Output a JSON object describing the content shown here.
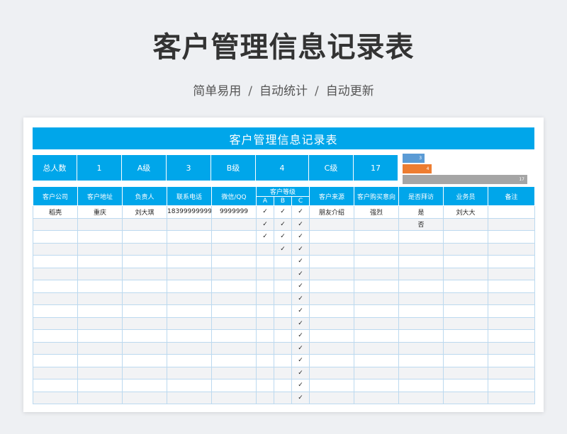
{
  "page": {
    "title": "客户管理信息记录表",
    "subtitle_parts": [
      "简单易用",
      "自动统计",
      "自动更新"
    ],
    "separator": "/"
  },
  "sheet": {
    "title": "客户管理信息记录表",
    "summary": [
      {
        "label": "总人数",
        "value": "1"
      },
      {
        "label": "A级",
        "value": "3"
      },
      {
        "label": "B级",
        "value": "4"
      },
      {
        "label": "C级",
        "value": "17"
      }
    ],
    "bars": [
      {
        "label": "3",
        "value": 3
      },
      {
        "label": "4",
        "value": 4
      },
      {
        "label": "17",
        "value": 17
      }
    ],
    "headers": {
      "company": "客户公司",
      "address": "客户地址",
      "owner": "负责人",
      "phone": "联系电话",
      "wechat": "微信/QQ",
      "level": "客户等级",
      "level_a": "A",
      "level_b": "B",
      "level_c": "C",
      "source": "客户来源",
      "intent": "客户购买意向",
      "visited": "是否拜访",
      "salesman": "业务员",
      "remark": "备注"
    },
    "check_mark": "✓",
    "rows": [
      {
        "company": "稻壳",
        "address": "重庆",
        "owner": "刘大琪",
        "phone": "18399999999",
        "wechat": "9999999",
        "a": true,
        "b": true,
        "c": true,
        "source": "朋友介绍",
        "intent": "强烈",
        "visited": "是",
        "salesman": "刘大大",
        "remark": ""
      },
      {
        "company": "",
        "address": "",
        "owner": "",
        "phone": "",
        "wechat": "",
        "a": true,
        "b": true,
        "c": true,
        "source": "",
        "intent": "",
        "visited": "否",
        "salesman": "",
        "remark": ""
      },
      {
        "company": "",
        "address": "",
        "owner": "",
        "phone": "",
        "wechat": "",
        "a": true,
        "b": true,
        "c": true,
        "source": "",
        "intent": "",
        "visited": "",
        "salesman": "",
        "remark": ""
      },
      {
        "company": "",
        "address": "",
        "owner": "",
        "phone": "",
        "wechat": "",
        "a": false,
        "b": true,
        "c": true,
        "source": "",
        "intent": "",
        "visited": "",
        "salesman": "",
        "remark": ""
      },
      {
        "company": "",
        "address": "",
        "owner": "",
        "phone": "",
        "wechat": "",
        "a": false,
        "b": false,
        "c": true,
        "source": "",
        "intent": "",
        "visited": "",
        "salesman": "",
        "remark": ""
      },
      {
        "company": "",
        "address": "",
        "owner": "",
        "phone": "",
        "wechat": "",
        "a": false,
        "b": false,
        "c": true,
        "source": "",
        "intent": "",
        "visited": "",
        "salesman": "",
        "remark": ""
      },
      {
        "company": "",
        "address": "",
        "owner": "",
        "phone": "",
        "wechat": "",
        "a": false,
        "b": false,
        "c": true,
        "source": "",
        "intent": "",
        "visited": "",
        "salesman": "",
        "remark": ""
      },
      {
        "company": "",
        "address": "",
        "owner": "",
        "phone": "",
        "wechat": "",
        "a": false,
        "b": false,
        "c": true,
        "source": "",
        "intent": "",
        "visited": "",
        "salesman": "",
        "remark": ""
      },
      {
        "company": "",
        "address": "",
        "owner": "",
        "phone": "",
        "wechat": "",
        "a": false,
        "b": false,
        "c": true,
        "source": "",
        "intent": "",
        "visited": "",
        "salesman": "",
        "remark": ""
      },
      {
        "company": "",
        "address": "",
        "owner": "",
        "phone": "",
        "wechat": "",
        "a": false,
        "b": false,
        "c": true,
        "source": "",
        "intent": "",
        "visited": "",
        "salesman": "",
        "remark": ""
      },
      {
        "company": "",
        "address": "",
        "owner": "",
        "phone": "",
        "wechat": "",
        "a": false,
        "b": false,
        "c": true,
        "source": "",
        "intent": "",
        "visited": "",
        "salesman": "",
        "remark": ""
      },
      {
        "company": "",
        "address": "",
        "owner": "",
        "phone": "",
        "wechat": "",
        "a": false,
        "b": false,
        "c": true,
        "source": "",
        "intent": "",
        "visited": "",
        "salesman": "",
        "remark": ""
      },
      {
        "company": "",
        "address": "",
        "owner": "",
        "phone": "",
        "wechat": "",
        "a": false,
        "b": false,
        "c": true,
        "source": "",
        "intent": "",
        "visited": "",
        "salesman": "",
        "remark": ""
      },
      {
        "company": "",
        "address": "",
        "owner": "",
        "phone": "",
        "wechat": "",
        "a": false,
        "b": false,
        "c": true,
        "source": "",
        "intent": "",
        "visited": "",
        "salesman": "",
        "remark": ""
      },
      {
        "company": "",
        "address": "",
        "owner": "",
        "phone": "",
        "wechat": "",
        "a": false,
        "b": false,
        "c": true,
        "source": "",
        "intent": "",
        "visited": "",
        "salesman": "",
        "remark": ""
      },
      {
        "company": "",
        "address": "",
        "owner": "",
        "phone": "",
        "wechat": "",
        "a": false,
        "b": false,
        "c": true,
        "source": "",
        "intent": "",
        "visited": "",
        "salesman": "",
        "remark": ""
      }
    ]
  },
  "colors": {
    "accent": "#00a6ea",
    "bar_a": "#5b9bd5",
    "bar_b": "#ed7d31",
    "bar_c": "#a5a5a5"
  }
}
